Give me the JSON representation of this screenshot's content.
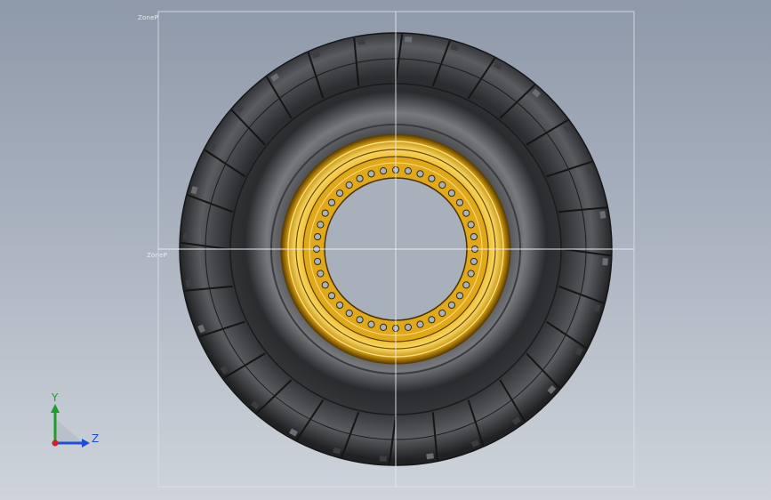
{
  "viewport": {
    "planes": {
      "top": "ZoneP",
      "front": "ZoneP"
    },
    "triad": {
      "y_label": "Y",
      "z_label": "Z"
    }
  },
  "colors": {
    "tire_dark": "#1e1f21",
    "tire_mid": "#4a4c50",
    "tire_light": "#8c8f94",
    "rim_gold": "#e3ad1a",
    "rim_light": "#f7d35a",
    "rim_dark": "#8a6305",
    "bolt_fill": "#a9b2bd",
    "plane_line": "#e6e9ee",
    "y_axis": "#1f9c2e",
    "z_axis": "#1d4fd6"
  }
}
